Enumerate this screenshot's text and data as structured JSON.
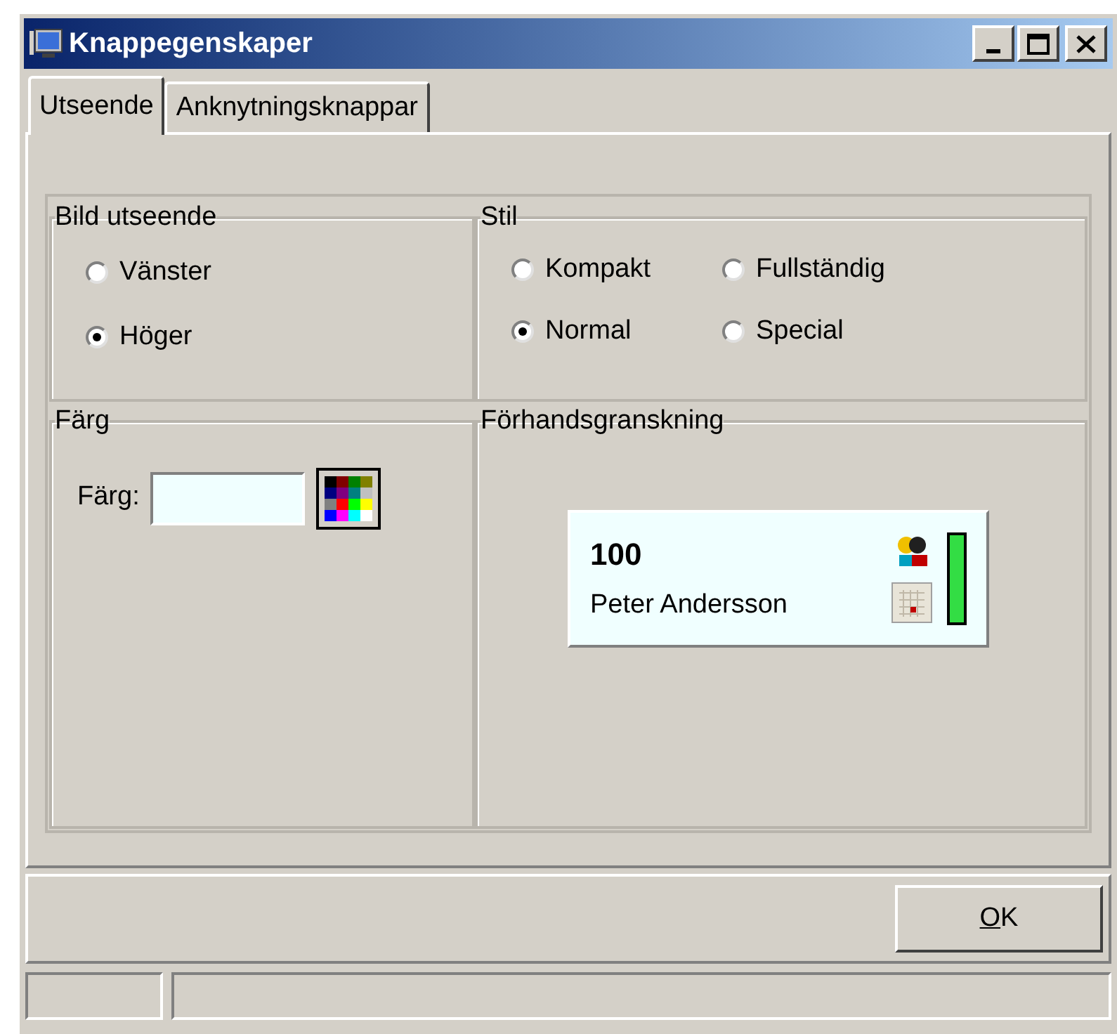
{
  "window": {
    "title": "Knappegenskaper"
  },
  "tabs": [
    {
      "label": "Utseende",
      "selected": true
    },
    {
      "label": "Anknytningsknappar",
      "selected": false
    }
  ],
  "image_group": {
    "title": "Bild utseende",
    "options": [
      {
        "label": "Vänster",
        "selected": false
      },
      {
        "label": "Höger",
        "selected": true
      }
    ]
  },
  "style_group": {
    "title": "Stil",
    "options": [
      {
        "label": "Kompakt",
        "selected": false
      },
      {
        "label": "Fullständig",
        "selected": false
      },
      {
        "label": "Normal",
        "selected": true
      },
      {
        "label": "Special",
        "selected": false
      }
    ]
  },
  "color_group": {
    "title": "Färg",
    "label": "Färg:"
  },
  "preview_group": {
    "title": "Förhandsgranskning",
    "number": "100",
    "name": "Peter Andersson"
  },
  "buttons": [
    "OK"
  ]
}
